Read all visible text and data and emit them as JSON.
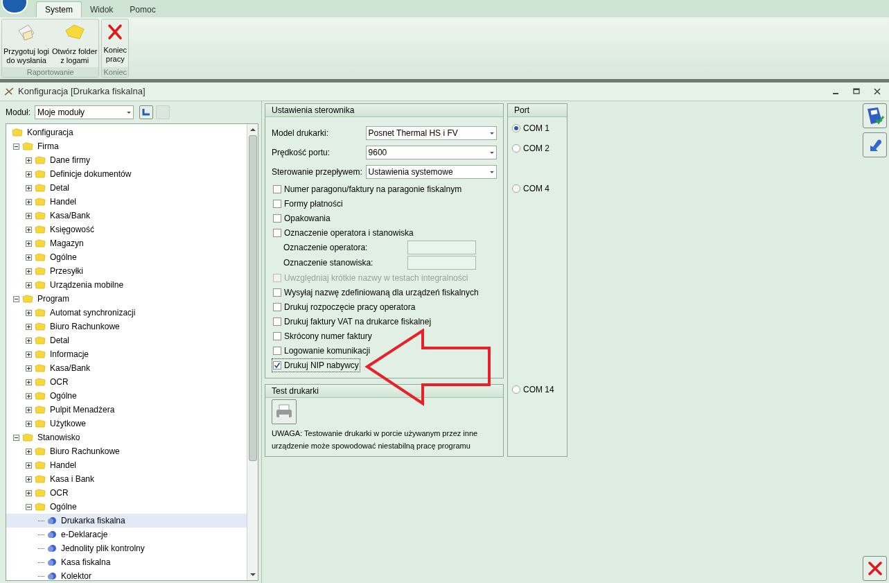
{
  "ribbon": {
    "tabs": [
      {
        "label": "System",
        "selected": true
      },
      {
        "label": "Widok",
        "selected": false
      },
      {
        "label": "Pomoc",
        "selected": false
      }
    ],
    "groups": [
      {
        "label": "Raportowanie",
        "buttons": [
          {
            "kind": "envelope",
            "label": "Przygotuj logi\ndo wysłania"
          },
          {
            "kind": "folder",
            "label": "Otwórz folder\nz logami"
          }
        ]
      },
      {
        "label": "Koniec",
        "buttons": [
          {
            "kind": "close",
            "label": "Koniec\npracy"
          }
        ]
      }
    ]
  },
  "window": {
    "title": "Konfiguracja [Drukarka fiskalna]"
  },
  "module": {
    "label": "Moduł:",
    "value": "Moje moduły"
  },
  "tree": [
    {
      "label": "Konfiguracja",
      "kind": "folder",
      "selected": false,
      "children": [
        {
          "label": "Firma",
          "kind": "folder",
          "expanded": true,
          "selected": false,
          "children": [
            {
              "label": "Dane firmy",
              "kind": "folder",
              "expanded": false,
              "selected": false
            },
            {
              "label": "Definicje dokumentów",
              "kind": "folder",
              "expanded": false,
              "selected": false
            },
            {
              "label": "Detal",
              "kind": "folder",
              "expanded": false,
              "selected": false
            },
            {
              "label": "Handel",
              "kind": "folder",
              "expanded": false,
              "selected": false
            },
            {
              "label": "Kasa/Bank",
              "kind": "folder",
              "expanded": false,
              "selected": false
            },
            {
              "label": "Księgowość",
              "kind": "folder",
              "expanded": false,
              "selected": false
            },
            {
              "label": "Magazyn",
              "kind": "folder",
              "expanded": false,
              "selected": false
            },
            {
              "label": "Ogólne",
              "kind": "folder",
              "expanded": false,
              "selected": false
            },
            {
              "label": "Przesyłki",
              "kind": "folder",
              "expanded": false,
              "selected": false
            },
            {
              "label": "Urządzenia mobilne",
              "kind": "folder",
              "expanded": false,
              "selected": false
            }
          ]
        },
        {
          "label": "Program",
          "kind": "folder",
          "expanded": true,
          "selected": false,
          "children": [
            {
              "label": "Automat synchronizacji",
              "kind": "folder",
              "expanded": false,
              "selected": false
            },
            {
              "label": "Biuro Rachunkowe",
              "kind": "folder",
              "expanded": false,
              "selected": false
            },
            {
              "label": "Detal",
              "kind": "folder",
              "expanded": false,
              "selected": false
            },
            {
              "label": "Informacje",
              "kind": "folder",
              "expanded": false,
              "selected": false
            },
            {
              "label": "Kasa/Bank",
              "kind": "folder",
              "expanded": false,
              "selected": false
            },
            {
              "label": "OCR",
              "kind": "folder",
              "expanded": false,
              "selected": false
            },
            {
              "label": "Ogólne",
              "kind": "folder",
              "expanded": false,
              "selected": false
            },
            {
              "label": "Pulpit Menadżera",
              "kind": "folder",
              "expanded": false,
              "selected": false
            },
            {
              "label": "Użytkowe",
              "kind": "folder",
              "expanded": false,
              "selected": false
            }
          ]
        },
        {
          "label": "Stanowisko",
          "kind": "folder",
          "expanded": true,
          "selected": false,
          "children": [
            {
              "label": "Biuro Rachunkowe",
              "kind": "folder",
              "expanded": false,
              "selected": false
            },
            {
              "label": "Handel",
              "kind": "folder",
              "expanded": false,
              "selected": false
            },
            {
              "label": "Kasa i Bank",
              "kind": "folder",
              "expanded": false,
              "selected": false
            },
            {
              "label": "OCR",
              "kind": "folder",
              "expanded": false,
              "selected": false
            },
            {
              "label": "Ogólne",
              "kind": "folder",
              "expanded": true,
              "selected": false,
              "children": [
                {
                  "label": "Drukarka fiskalna",
                  "kind": "leaf",
                  "selected": true
                },
                {
                  "label": "e-Deklaracje",
                  "kind": "leaf",
                  "selected": false
                },
                {
                  "label": "Jednolity plik kontrolny",
                  "kind": "leaf",
                  "selected": false
                },
                {
                  "label": "Kasa fiskalna",
                  "kind": "leaf",
                  "selected": false
                },
                {
                  "label": "Kolektor",
                  "kind": "leaf",
                  "selected": false
                }
              ]
            }
          ]
        }
      ]
    }
  ],
  "settings": {
    "title": "Ustawienia sterownika",
    "selects": [
      {
        "label": "Model drukarki:",
        "value": "Posnet Thermal HS i FV"
      },
      {
        "label": "Prędkość portu:",
        "value": "9600"
      },
      {
        "label": "Sterowanie przepływem:",
        "value": "Ustawienia systemowe"
      }
    ],
    "items": [
      {
        "kind": "checkbox",
        "label": "Numer paragonu/faktury na paragonie fiskalnym",
        "checked": false,
        "disabled": false,
        "focused": false
      },
      {
        "kind": "checkbox",
        "label": "Formy płatności",
        "checked": false,
        "disabled": false,
        "focused": false
      },
      {
        "kind": "checkbox",
        "label": "Opakowania",
        "checked": false,
        "disabled": false,
        "focused": false
      },
      {
        "kind": "checkbox",
        "label": "Oznaczenie operatora i stanowiska",
        "checked": false,
        "disabled": false,
        "focused": false
      },
      {
        "kind": "field",
        "label": "Oznaczenie operatora:"
      },
      {
        "kind": "field",
        "label": "Oznaczenie stanowiska:"
      },
      {
        "kind": "checkbox",
        "label": "Uwzględniaj krótkie nazwy w testach integralności",
        "checked": false,
        "disabled": true,
        "focused": false
      },
      {
        "kind": "checkbox",
        "label": "Wysyłaj nazwę zdefiniowaną dla urządzeń fiskalnych",
        "checked": false,
        "disabled": false,
        "focused": false
      },
      {
        "kind": "checkbox",
        "label": "Drukuj rozpoczęcie pracy operatora",
        "checked": false,
        "disabled": false,
        "focused": false
      },
      {
        "kind": "checkbox",
        "label": "Drukuj faktury VAT na drukarce fiskalnej",
        "checked": false,
        "disabled": false,
        "focused": false
      },
      {
        "kind": "checkbox",
        "label": "Skrócony numer faktury",
        "checked": false,
        "disabled": false,
        "focused": false
      },
      {
        "kind": "checkbox",
        "label": "Logowanie komunikacji",
        "checked": false,
        "disabled": false,
        "focused": false
      },
      {
        "kind": "checkbox",
        "label": "Drukuj NIP nabywcy",
        "checked": true,
        "disabled": false,
        "focused": true
      }
    ]
  },
  "test": {
    "title": "Test drukarki",
    "note": "UWAGA: Testowanie drukarki w porcie używanym przez inne urządzenie może spowodować niestabilną pracę programu"
  },
  "port": {
    "title": "Port",
    "options": [
      {
        "label": "COM 1",
        "selected": true
      },
      {
        "label": "COM 2",
        "selected": false
      },
      {
        "label": "COM 4",
        "selected": false
      },
      {
        "label": "COM 14",
        "selected": false
      }
    ]
  }
}
